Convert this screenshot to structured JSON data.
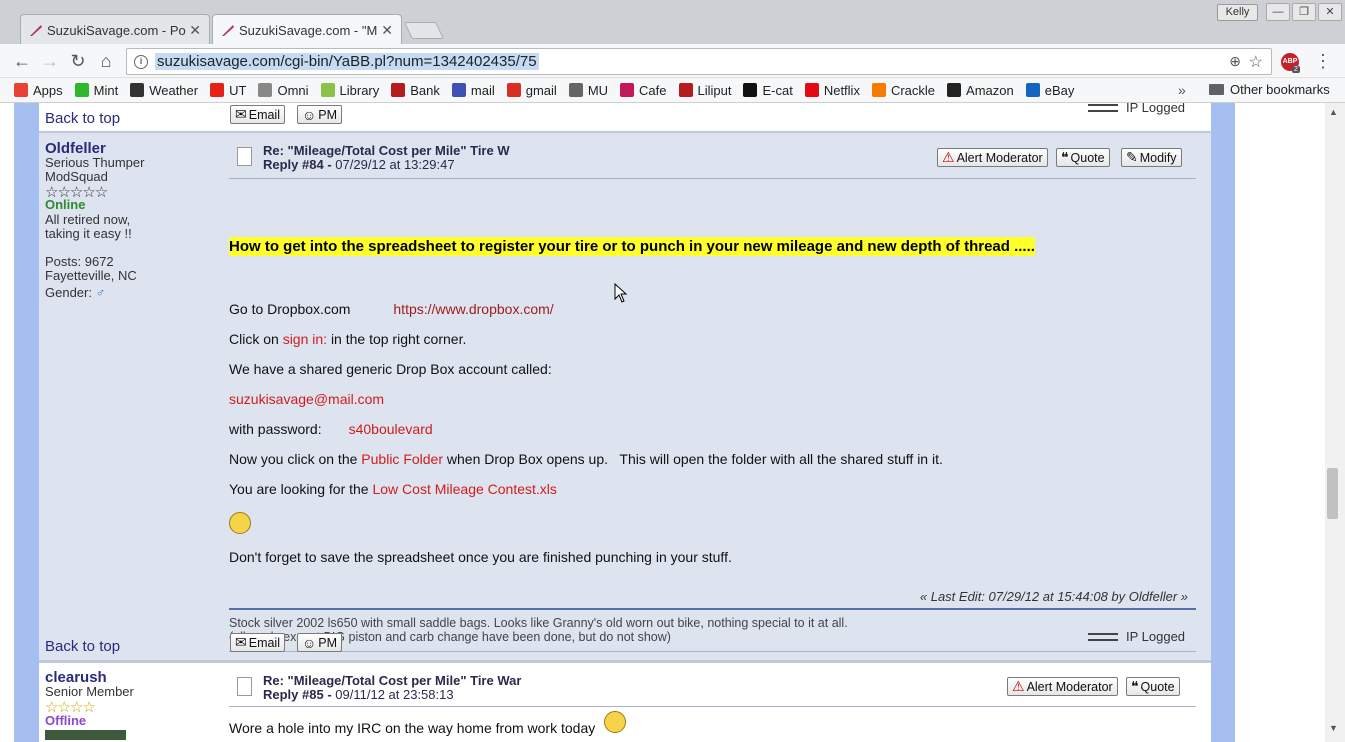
{
  "browser": {
    "tabs": [
      {
        "label": "SuzukiSavage.com - Po"
      },
      {
        "label": "SuzukiSavage.com - \"M"
      }
    ],
    "profile_name": "Kelly",
    "url": "suzukisavage.com/cgi-bin/YaBB.pl?num=1342402435/75",
    "abp_label": "ABP",
    "abp_count": "2"
  },
  "bookmarks": [
    {
      "label": "Apps",
      "icon": "apps-grid-icon",
      "color": "#e94235"
    },
    {
      "label": "Mint",
      "icon": "mint-icon",
      "color": "#2eb82e"
    },
    {
      "label": "Weather",
      "icon": "weather-icon",
      "color": "#333333"
    },
    {
      "label": "UT",
      "icon": "youtube-icon",
      "color": "#e62117"
    },
    {
      "label": "Omni",
      "icon": "page-icon",
      "color": "#888888"
    },
    {
      "label": "Library",
      "icon": "library-icon",
      "color": "#8bc34a"
    },
    {
      "label": "Bank",
      "icon": "bank-icon",
      "color": "#b71c1c"
    },
    {
      "label": "mail",
      "icon": "mail-m-icon",
      "color": "#3f51b5"
    },
    {
      "label": "gmail",
      "icon": "gmail-icon",
      "color": "#d93025"
    },
    {
      "label": "MU",
      "icon": "envelope-icon",
      "color": "#666666"
    },
    {
      "label": "Cafe",
      "icon": "feather-icon",
      "color": "#c2185b"
    },
    {
      "label": "Liliput",
      "icon": "liliput-icon",
      "color": "#b71c1c"
    },
    {
      "label": "E-cat",
      "icon": "ecat-icon",
      "color": "#111111"
    },
    {
      "label": "Netflix",
      "icon": "netflix-icon",
      "color": "#e50914"
    },
    {
      "label": "Crackle",
      "icon": "crackle-icon",
      "color": "#f57c00"
    },
    {
      "label": "Amazon",
      "icon": "amazon-icon",
      "color": "#222222"
    },
    {
      "label": "eBay",
      "icon": "ebay-icon",
      "color": "#1565c0"
    }
  ],
  "bookmarks_more": "»",
  "other_bookmarks": "Other bookmarks",
  "forum": {
    "back_to_top": "Back to top",
    "email_label": "Email",
    "pm_label": "PM",
    "ip_logged": "IP Logged",
    "alert_label": "Alert Moderator",
    "quote_label": "Quote",
    "modify_label": "Modify",
    "post84": {
      "user": "Oldfeller",
      "rank": "Serious Thumper",
      "group": "ModSquad",
      "stars": "☆☆☆☆☆",
      "status": "Online",
      "personal_text_1": "All retired now,",
      "personal_text_2": "taking it easy !!",
      "posts": "Posts: 9672",
      "location": "Fayetteville, NC",
      "gender_label": "Gender:",
      "subject": "Re: \"Mileage/Total Cost per Mile\" Tire W",
      "reply_num": "Reply #84 -",
      "reply_date": "07/29/12 at 13:29:47",
      "headline": "How to get into the spreadsheet to register your tire or to punch in your new mileage and new depth of thread .....",
      "line1_a": "Go to Dropbox.com",
      "line1_link": "https://www.dropbox.com/",
      "line2_a": "Click on",
      "line2_link": "sign in:",
      "line2_b": "in the top right corner.",
      "line3": "We have a shared generic Drop Box account called:",
      "line4_link": "suzukisavage@mail.com",
      "line5_a": "with password:",
      "line5_link": "s40boulevard",
      "line6_a": "Now you click on the",
      "line6_link": "Public Folder",
      "line6_b": "when Drop Box opens up.   This will open the folder with all the shared stuff in it.",
      "line7_a": "You are looking for the",
      "line7_link": "Low Cost Mileage Contest.xls",
      "line8": "Don't forget to save the spreadsheet once you are finished punching in your stuff.",
      "last_edit": "« Last Edit: 07/29/12 at 15:44:08 by Oldfeller »",
      "sig_1": "Stock silver 2002 ls650 with small saddle bags. Looks like Granny's old worn out bike, nothing special to it at all.",
      "sig_2": "(all mods except BIG piston and carb change have been done, but do not show)"
    },
    "post85": {
      "user": "clearush",
      "rank": "Senior Member",
      "stars": "☆☆☆☆",
      "status": "Offline",
      "subject": "Re: \"Mileage/Total Cost per Mile\" Tire War",
      "reply_num": "Reply #85 -",
      "reply_date": "09/11/12 at 23:58:13",
      "body": "Wore a hole into my IRC on the way home from work today"
    }
  }
}
